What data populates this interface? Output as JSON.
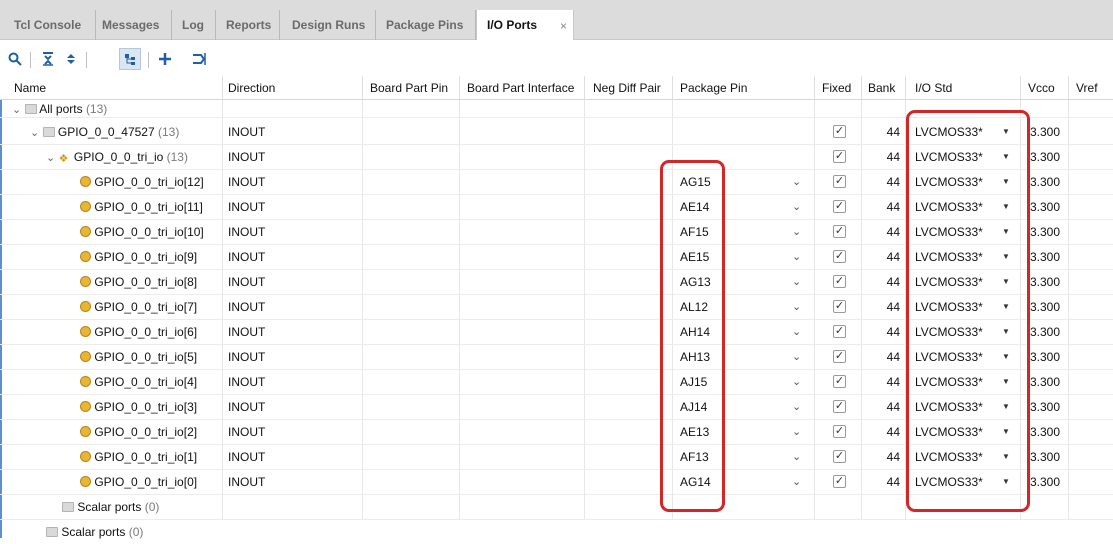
{
  "tabs": [
    {
      "label": "Tcl Console"
    },
    {
      "label": "Messages"
    },
    {
      "label": "Log"
    },
    {
      "label": "Reports"
    },
    {
      "label": "Design Runs"
    },
    {
      "label": "Package Pins"
    },
    {
      "label": "I/O Ports",
      "close": "×"
    }
  ],
  "columns": {
    "name": "Name",
    "direction": "Direction",
    "board_part_pin": "Board Part Pin",
    "board_part_interface": "Board Part Interface",
    "neg_diff_pair": "Neg Diff Pair",
    "package_pin": "Package Pin",
    "fixed": "Fixed",
    "bank": "Bank",
    "io_std": "I/O Std",
    "vcco": "Vcco",
    "vref": "Vref"
  },
  "tree": {
    "all_ports": {
      "label": "All ports",
      "count": "(13)"
    },
    "gpio_group": {
      "label": "GPIO_0_0_47527",
      "count": "(13)",
      "direction": "INOUT",
      "bank": "44",
      "io_std": "LVCMOS33*",
      "vcco": "3.300"
    },
    "tri_io": {
      "label": "GPIO_0_0_tri_io",
      "count": "(13)",
      "direction": "INOUT",
      "bank": "44",
      "io_std": "LVCMOS33*",
      "vcco": "3.300"
    },
    "ports": [
      {
        "name": "GPIO_0_0_tri_io[12]",
        "direction": "INOUT",
        "pin": "AG15",
        "bank": "44",
        "io_std": "LVCMOS33*",
        "vcco": "3.300"
      },
      {
        "name": "GPIO_0_0_tri_io[11]",
        "direction": "INOUT",
        "pin": "AE14",
        "bank": "44",
        "io_std": "LVCMOS33*",
        "vcco": "3.300"
      },
      {
        "name": "GPIO_0_0_tri_io[10]",
        "direction": "INOUT",
        "pin": "AF15",
        "bank": "44",
        "io_std": "LVCMOS33*",
        "vcco": "3.300"
      },
      {
        "name": "GPIO_0_0_tri_io[9]",
        "direction": "INOUT",
        "pin": "AE15",
        "bank": "44",
        "io_std": "LVCMOS33*",
        "vcco": "3.300"
      },
      {
        "name": "GPIO_0_0_tri_io[8]",
        "direction": "INOUT",
        "pin": "AG13",
        "bank": "44",
        "io_std": "LVCMOS33*",
        "vcco": "3.300"
      },
      {
        "name": "GPIO_0_0_tri_io[7]",
        "direction": "INOUT",
        "pin": "AL12",
        "bank": "44",
        "io_std": "LVCMOS33*",
        "vcco": "3.300"
      },
      {
        "name": "GPIO_0_0_tri_io[6]",
        "direction": "INOUT",
        "pin": "AH14",
        "bank": "44",
        "io_std": "LVCMOS33*",
        "vcco": "3.300"
      },
      {
        "name": "GPIO_0_0_tri_io[5]",
        "direction": "INOUT",
        "pin": "AH13",
        "bank": "44",
        "io_std": "LVCMOS33*",
        "vcco": "3.300"
      },
      {
        "name": "GPIO_0_0_tri_io[4]",
        "direction": "INOUT",
        "pin": "AJ15",
        "bank": "44",
        "io_std": "LVCMOS33*",
        "vcco": "3.300"
      },
      {
        "name": "GPIO_0_0_tri_io[3]",
        "direction": "INOUT",
        "pin": "AJ14",
        "bank": "44",
        "io_std": "LVCMOS33*",
        "vcco": "3.300"
      },
      {
        "name": "GPIO_0_0_tri_io[2]",
        "direction": "INOUT",
        "pin": "AE13",
        "bank": "44",
        "io_std": "LVCMOS33*",
        "vcco": "3.300"
      },
      {
        "name": "GPIO_0_0_tri_io[1]",
        "direction": "INOUT",
        "pin": "AF13",
        "bank": "44",
        "io_std": "LVCMOS33*",
        "vcco": "3.300"
      },
      {
        "name": "GPIO_0_0_tri_io[0]",
        "direction": "INOUT",
        "pin": "AG14",
        "bank": "44",
        "io_std": "LVCMOS33*",
        "vcco": "3.300"
      }
    ],
    "scalar_inner": {
      "label": "Scalar ports",
      "count": "(0)"
    },
    "scalar_outer": {
      "label": "Scalar ports",
      "count": "(0)"
    }
  },
  "toolbar": {
    "icons": [
      "search-icon",
      "collapse-all-icon",
      "expand-all-icon",
      "group-by-interface-icon",
      "add-icon",
      "auto-assign-icon"
    ]
  },
  "colors": {
    "highlight": "#d42626",
    "accent": "#1e5fa6"
  }
}
